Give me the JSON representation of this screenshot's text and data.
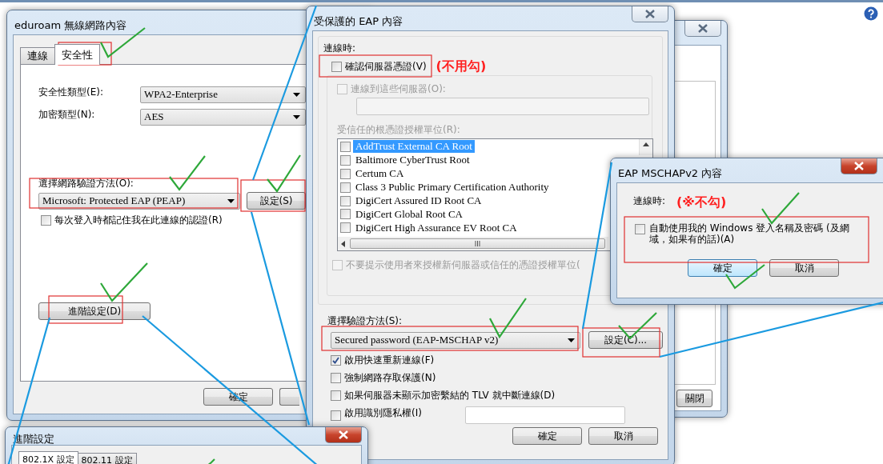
{
  "network_window": {
    "buttons": [
      "關閉"
    ]
  },
  "wireless_properties": {
    "title": "eduroam 無線網路內容",
    "tabs": [
      {
        "label": "連線",
        "selected": false
      },
      {
        "label": "安全性",
        "selected": true
      }
    ],
    "fields": [
      {
        "label": "安全性類型(E):",
        "value": "WPA2-Enterprise"
      },
      {
        "label": "加密類型(N):",
        "value": "AES"
      }
    ],
    "auth_method": {
      "label": "選擇網路驗證方法(O):",
      "value": "Microsoft: Protected EAP (PEAP)",
      "button": "設定(S)"
    },
    "remember": {
      "label": "每次登入時都記住我在此連線的認證(R)",
      "checked": false
    },
    "advanced_button": "進階設定(D)",
    "buttons": [
      "確定"
    ]
  },
  "peap_properties": {
    "title": "受保護的 EAP 內容",
    "section_label": "連線時:",
    "verify_server": {
      "label": "確認伺服器憑證(V)",
      "checked": false,
      "disabled": false
    },
    "verify_note": "(不用勾)",
    "connect_servers": {
      "label": "連線到這些伺服器(O):",
      "checked": false,
      "disabled": true
    },
    "trusted_ca": {
      "label": "受信任的根憑證授權單位(R):",
      "disabled": true,
      "items": [
        {
          "label": "AddTrust External CA Root",
          "checked": false,
          "selected": true
        },
        {
          "label": "Baltimore CyberTrust Root",
          "checked": false,
          "selected": false
        },
        {
          "label": "Certum CA",
          "checked": false,
          "selected": false
        },
        {
          "label": "Class 3 Public Primary Certification Authority",
          "checked": false,
          "selected": false
        },
        {
          "label": "DigiCert Assured ID Root CA",
          "checked": false,
          "selected": false
        },
        {
          "label": "DigiCert Global Root CA",
          "checked": false,
          "selected": false
        },
        {
          "label": "DigiCert High Assurance EV Root CA",
          "checked": false,
          "selected": false
        }
      ]
    },
    "no_prompt": {
      "label": "不要提示使用者來授權新伺服器或信任的憑證授權單位(",
      "checked": false,
      "disabled": true
    },
    "auth_method": {
      "label": "選擇驗證方法(S):",
      "value": "Secured password (EAP-MSCHAP v2)",
      "button": "設定(C)..."
    },
    "options": [
      {
        "label": "啟用快速重新連線(F)",
        "checked": true,
        "kind": "checkbox"
      },
      {
        "label": "強制網路存取保護(N)",
        "checked": false,
        "kind": "checkbox"
      },
      {
        "label": "如果伺服器未顯示加密繫結的 TLV 就中斷連線(D)",
        "checked": false,
        "kind": "checkbox"
      },
      {
        "label": "啟用識別隱私權(I)",
        "checked": false,
        "kind": "checkbox_field"
      }
    ],
    "buttons": [
      "確定",
      "取消"
    ]
  },
  "mschap_properties": {
    "title": "EAP MSCHAPv2 內容",
    "section_label": "連線時:",
    "note": "(※不勾)",
    "auto_login": {
      "label": "自動使用我的 Windows 登入名稱及密碼 (及網域，如果有的話)(A)",
      "checked": false
    },
    "buttons": [
      {
        "label": "確定",
        "default": true
      },
      {
        "label": "取消",
        "default": false
      }
    ]
  },
  "advanced_settings": {
    "title": "進階設定",
    "tabs": [
      {
        "label": "802.1X 設定",
        "selected": true
      },
      {
        "label": "802.11 設定",
        "selected": false
      }
    ]
  }
}
